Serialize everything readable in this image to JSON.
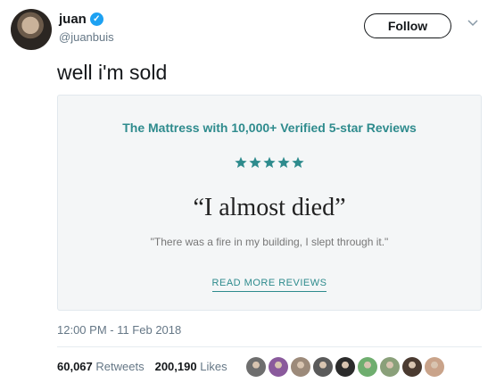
{
  "user": {
    "name": "juan",
    "handle": "@juanbuis",
    "verified_icon": "verified-badge-icon"
  },
  "follow_label": "Follow",
  "tweet_text": "well i'm sold",
  "card": {
    "headline": "The Mattress with 10,000+ Verified 5-star Reviews",
    "rating": 5,
    "quote": "“I almost died”",
    "subquote": "\"There was a fire in my building, I slept through it.\"",
    "read_more": "READ MORE REVIEWS"
  },
  "timestamp": "12:00 PM - 11 Feb 2018",
  "stats": {
    "retweets_count": "60,067",
    "retweets_label": "Retweets",
    "likes_count": "200,190",
    "likes_label": "Likes"
  },
  "colors": {
    "accent": "#2e8b8d",
    "verified": "#1da1f2",
    "muted": "#657786"
  },
  "liker_avatars": [
    "#6e6e6e",
    "#8a5a9c",
    "#9c8a7a",
    "#5a5a5a",
    "#2b2b2b",
    "#6fae6f",
    "#8aa07a",
    "#4a3a30",
    "#c9a38a"
  ]
}
